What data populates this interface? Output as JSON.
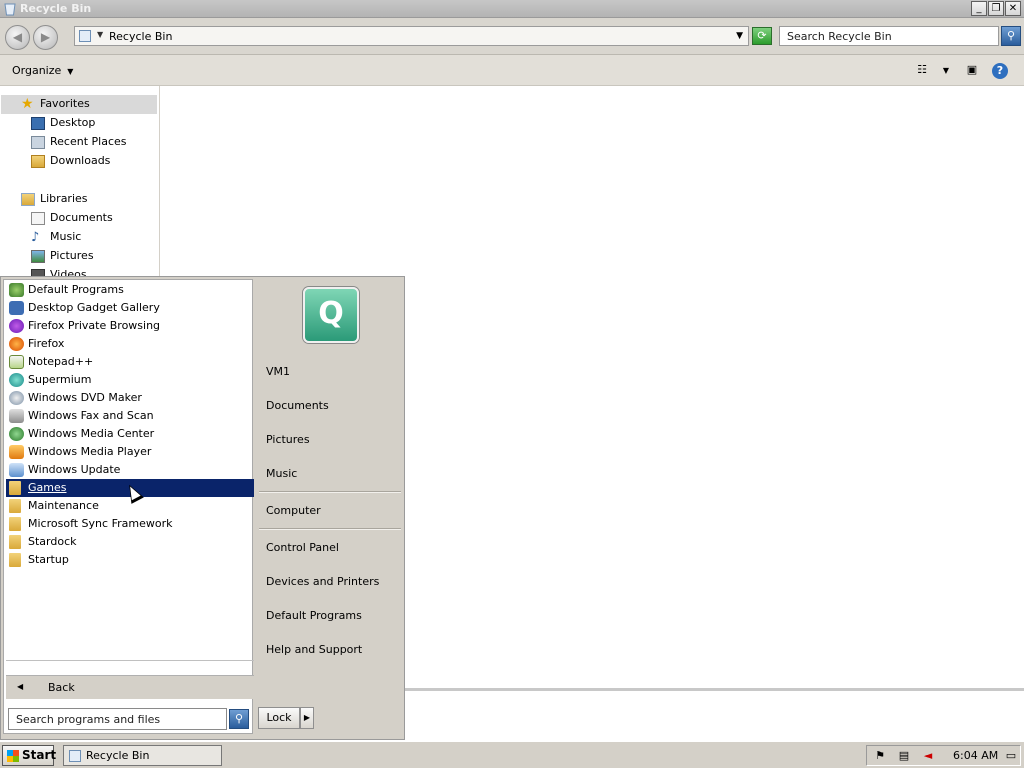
{
  "window": {
    "title": "Recycle Bin",
    "controls": {
      "minimize": "_",
      "restore": "❐",
      "close": "✕"
    }
  },
  "address": {
    "back": "◀",
    "forward": "▶",
    "path": "Recycle Bin",
    "search_placeholder": "Search Recycle Bin"
  },
  "toolbar": {
    "organize": "Organize"
  },
  "nav": {
    "favorites": {
      "label": "Favorites",
      "items": [
        "Desktop",
        "Recent Places",
        "Downloads"
      ]
    },
    "libraries": {
      "label": "Libraries",
      "items": [
        "Documents",
        "Music",
        "Pictures",
        "Videos"
      ]
    }
  },
  "start_menu": {
    "programs": [
      {
        "label": "Default Programs",
        "icon": "default-programs-icon",
        "color": "#4a8a3a"
      },
      {
        "label": "Desktop Gadget Gallery",
        "icon": "gadget-gallery-icon",
        "color": "#3d6db3"
      },
      {
        "label": "Firefox Private Browsing",
        "icon": "firefox-private-icon",
        "color": "#8a2be2"
      },
      {
        "label": "Firefox",
        "icon": "firefox-icon",
        "color": "#e66000"
      },
      {
        "label": "Notepad++",
        "icon": "notepadpp-icon",
        "color": "#86b83b"
      },
      {
        "label": "Supermium",
        "icon": "supermium-icon",
        "color": "#1aa5a5"
      },
      {
        "label": "Windows DVD Maker",
        "icon": "dvd-maker-icon",
        "color": "#7a8fa6"
      },
      {
        "label": "Windows Fax and Scan",
        "icon": "fax-scan-icon",
        "color": "#8d8d8d"
      },
      {
        "label": "Windows Media Center",
        "icon": "media-center-icon",
        "color": "#3a9a3a"
      },
      {
        "label": "Windows Media Player",
        "icon": "media-player-icon",
        "color": "#f08a1c"
      },
      {
        "label": "Windows Update",
        "icon": "windows-update-icon",
        "color": "#5b8fce"
      }
    ],
    "folders": [
      "Games",
      "Maintenance",
      "Microsoft Sync Framework",
      "Stardock",
      "Startup"
    ],
    "selected": "Games",
    "back": "Back",
    "search_placeholder": "Search programs and files",
    "right": {
      "user": "VM1",
      "group1": [
        "Documents",
        "Pictures",
        "Music"
      ],
      "group2": [
        "Computer"
      ],
      "group3": [
        "Control Panel",
        "Devices and Printers",
        "Default Programs",
        "Help and Support"
      ]
    },
    "lock": "Lock"
  },
  "taskbar": {
    "start": "Start",
    "task": "Recycle Bin",
    "clock": "6:04 AM"
  }
}
